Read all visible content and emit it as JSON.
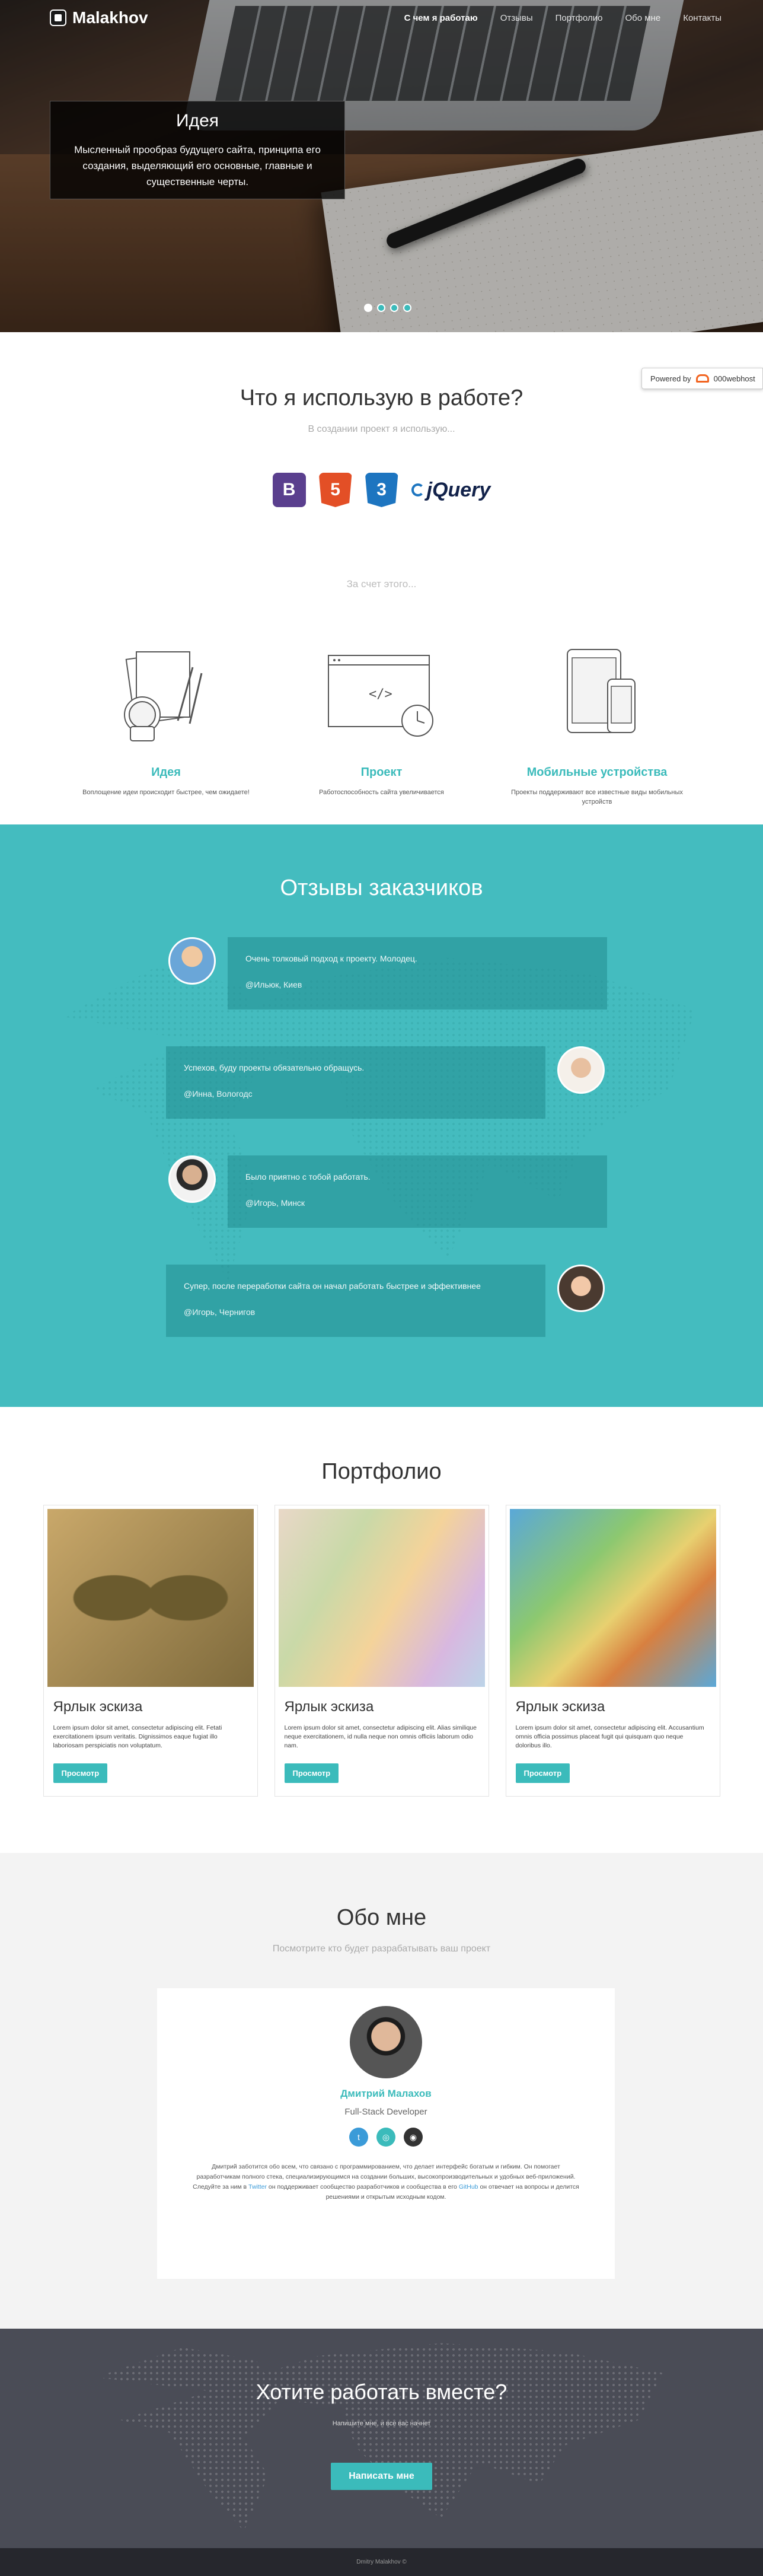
{
  "nav": {
    "brand": "Malakhov",
    "items": [
      "С чем я работаю",
      "Отзывы",
      "Портфолио",
      "Обо мне",
      "Контакты"
    ]
  },
  "hero": {
    "title": "Идея",
    "text": "Мысленный прообраз будущего сайта, принципа его создания, выделяющий его основные, главные и существенные черты.",
    "slides": 4,
    "active_slide": 1
  },
  "tools": {
    "title": "Что я использую в работе?",
    "subtitle": "В создании проект я использую...",
    "jquery": "jQuery",
    "why": "За счет этого...",
    "features": [
      {
        "title": "Идея",
        "text": "Воплощение идеи происходит быстрее, чем ожидаете!"
      },
      {
        "title": "Проект",
        "text": "Работоспособность сайта увеличивается"
      },
      {
        "title": "Мобильные устройства",
        "text": "Проекты поддерживают все известные виды мобильных устройств"
      }
    ]
  },
  "powered": {
    "label": "Powered by",
    "host": "000webhost"
  },
  "reviews": {
    "title": "Отзывы заказчиков",
    "items": [
      {
        "text": "Очень толковый подход к проекту. Молодец.",
        "who": "@Ильюк, Киев"
      },
      {
        "text": "Успехов, буду проекты обязательно обращусь.",
        "who": "@Инна, Вологодс"
      },
      {
        "text": "Было приятно с тобой работать.",
        "who": "@Игорь, Минск"
      },
      {
        "text": "Супер, после переработки сайта он начал работать быстрее и эффективнее",
        "who": "@Игорь, Чернигов"
      }
    ]
  },
  "portfolio": {
    "title": "Портфолио",
    "cards": [
      {
        "title": "Ярлык эскиза",
        "text": "Lorem ipsum dolor sit amet, consectetur adipiscing elit. Fetati exercitationem ipsum veritatis. Dignissimos eaque fugiat illo laboriosam perspiciatis non voluptatum.",
        "button": "Просмотр"
      },
      {
        "title": "Ярлык эскиза",
        "text": "Lorem ipsum dolor sit amet, consectetur adipiscing elit. Alias similique neque exercitationem, id nulla neque non omnis officiis laborum odio nam.",
        "button": "Просмотр"
      },
      {
        "title": "Ярлык эскиза",
        "text": "Lorem ipsum dolor sit amet, consectetur adipiscing elit. Accusantium omnis officia possimus placeat fugit qui quisquam quo neque doloribus illo.",
        "button": "Просмотр"
      }
    ]
  },
  "about": {
    "title": "Обо мне",
    "subtitle": "Посмотрите кто будет разрабатывать ваш проект",
    "name": "Дмитрий Малахов",
    "role": "Full-Stack Developer",
    "bio_1": "Дмитрий заботится обо всем, что связано с программированием, что делает интерфейс богатым и гибким. Он помогает разработчикам полного стека, специализирующимся на создании больших, высокопроизводительных и удобных веб-приложений. Следуйте за ним в",
    "bio_link_1": "Twitter",
    "bio_2": "он поддерживает сообщество разработчиков и сообщества в его",
    "bio_link_2": "GitHub",
    "bio_3": "он отвечает на вопросы и делится решениями и открытым исходным кодом."
  },
  "cta": {
    "title": "Хотите работать вместе?",
    "text": "Напишите мне, и все вас начнет",
    "button": "Написать мне"
  },
  "footer": {
    "text": "Dmitry Malakhov ©"
  },
  "colors": {
    "accent": "#3bbbbb",
    "reviews_bg": "#44bcbf",
    "cta_bg": "#4a4c56",
    "about_bg": "#f3f3f3"
  }
}
